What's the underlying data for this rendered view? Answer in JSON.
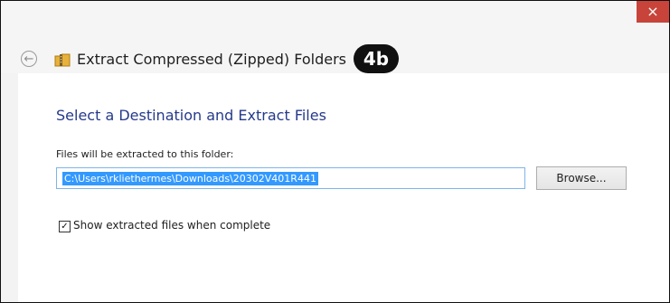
{
  "window": {
    "title": "Extract Compressed (Zipped) Folders",
    "badge": "4b",
    "close_glyph": "×",
    "back_glyph": "←"
  },
  "dialog": {
    "heading": "Select a Destination and Extract Files",
    "path_label": "Files will be extracted to this folder:",
    "path_value": "C:\\Users\\rkliethermes\\Downloads\\20302V401R441",
    "browse_label": "Browse...",
    "show_files_label": "Show extracted files when complete",
    "show_files_checked": true,
    "check_glyph": "✓"
  },
  "colors": {
    "heading": "#253a8a",
    "selection": "#3399ff",
    "close": "#c8443a"
  },
  "icons": [
    "back-arrow-icon",
    "zip-folder-icon",
    "close-icon",
    "checkmark-icon"
  ]
}
